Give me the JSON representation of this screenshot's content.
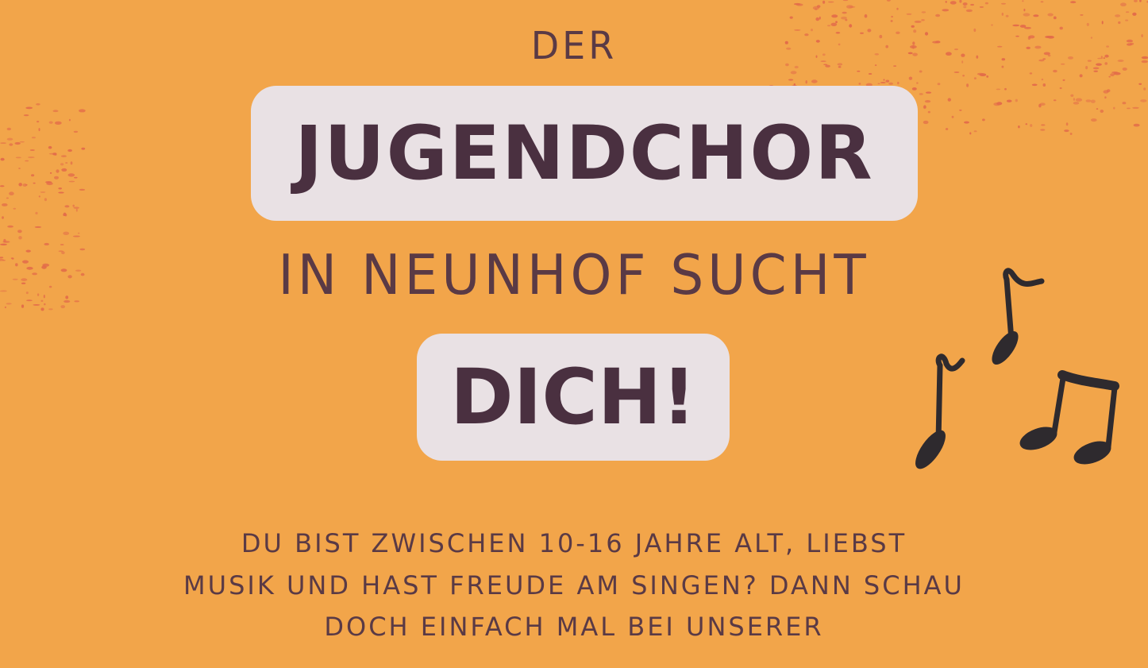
{
  "header": {
    "pre": "DER"
  },
  "title": {
    "main": "JUGENDCHOR"
  },
  "subtitle": {
    "text": "IN NEUNHOF SUCHT"
  },
  "callout": {
    "text": "DICH!"
  },
  "body": {
    "line1": "DU BIST ZWISCHEN 10-16 JAHRE ALT,  LIEBST",
    "line2": "MUSIK UND HAST FREUDE AM SINGEN? DANN SCHAU",
    "line3": "DOCH EINFACH MAL BEI UNSERER"
  },
  "colors": {
    "background": "#F2A54A",
    "pill": "#E9E1E4",
    "text": "#4A3040",
    "speckle": "#E0624A",
    "notes": "#2E2A2E"
  },
  "icons": [
    "music-notes-icon"
  ]
}
